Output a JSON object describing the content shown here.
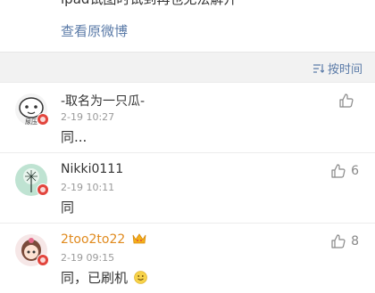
{
  "post": {
    "cut_text": "ipad试图时试到再也无法解开",
    "view_original": "查看原微博"
  },
  "sort": {
    "label": "按时间",
    "icon": "sort-icon"
  },
  "comments": [
    {
      "username": "-取名为一只瓜-",
      "time": "2-19 10:27",
      "text": "同...",
      "likes": "",
      "avatar_text": "尿压"
    },
    {
      "username": "Nikki0111",
      "time": "2-19 10:11",
      "text": "同",
      "likes": "6"
    },
    {
      "username": "2too2to22",
      "time": "2-19 09:15",
      "text": "同，已刷机",
      "likes": "8"
    }
  ],
  "colors": {
    "link": "#5b7ba8",
    "vip_name": "#e08a1e",
    "badge": "#e2453d"
  }
}
